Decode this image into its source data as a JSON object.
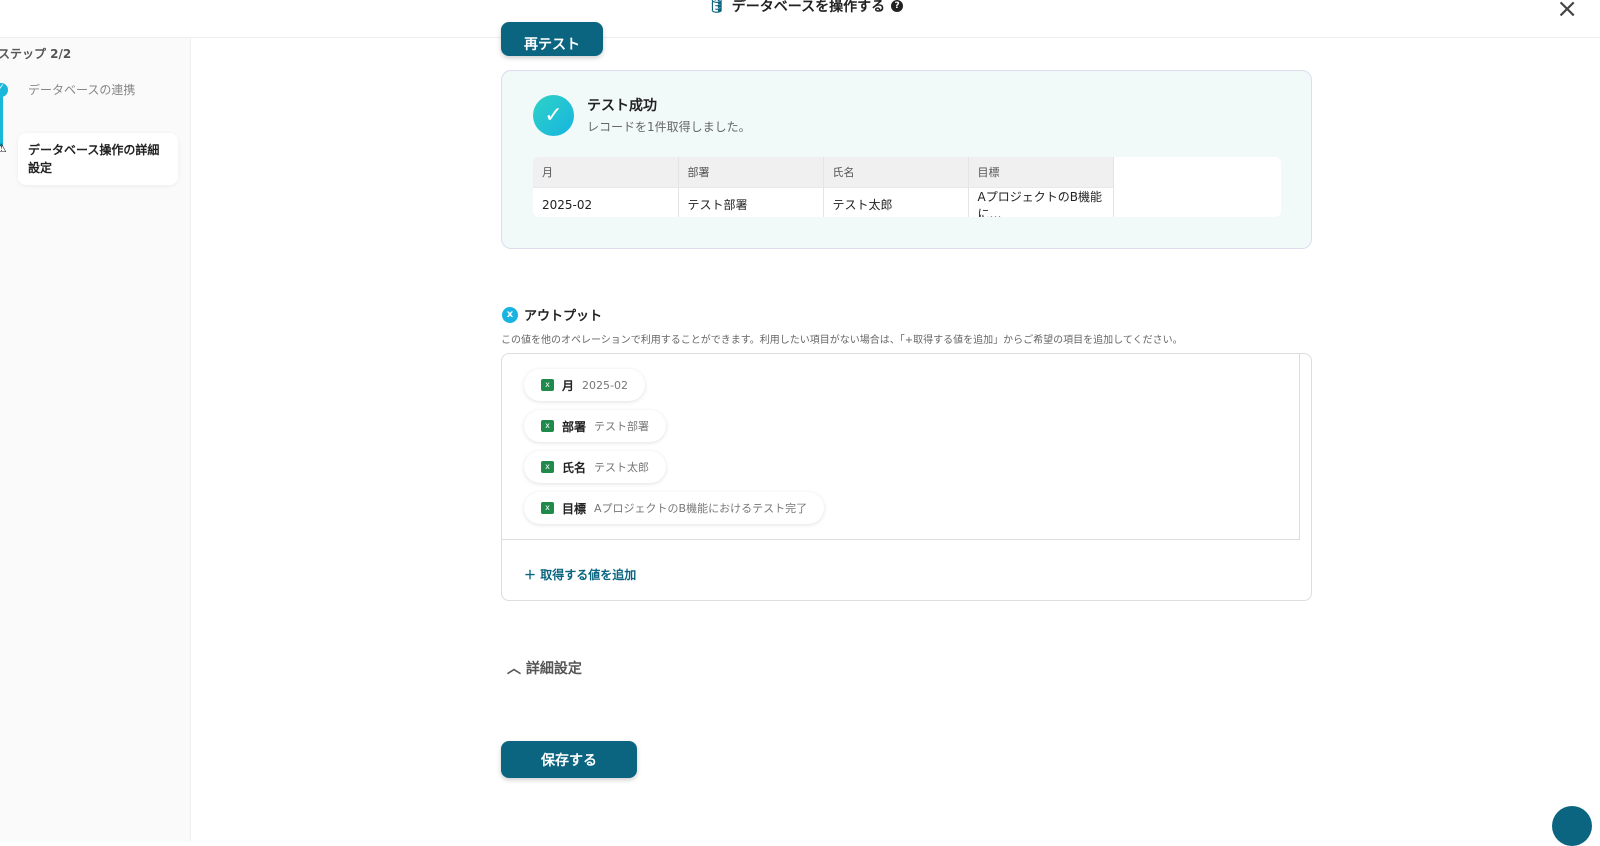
{
  "header": {
    "title": "データベースを操作する",
    "help_icon": "?",
    "close_icon": "×"
  },
  "sidebar": {
    "step_label": "ステップ 2/2",
    "steps": [
      {
        "label": "データベースの連携",
        "status": "done"
      },
      {
        "label": "データベース操作の詳細設定",
        "status": "warning"
      }
    ]
  },
  "retest_label": "再テスト",
  "test": {
    "title": "テスト成功",
    "subtitle": "レコードを1件取得しました。",
    "headers": [
      "月",
      "部署",
      "氏名",
      "目標"
    ],
    "row": [
      "2025-02",
      "テスト部署",
      "テスト太郎",
      "AプロジェクトのB機能に…"
    ]
  },
  "output": {
    "title": "アウトプット",
    "description": "この値を他のオペレーションで利用することができます。利用したい項目がない場合は、「+取得する値を追加」からご希望の項目を追加してください。",
    "items": [
      {
        "key": "月",
        "value": "2025-02"
      },
      {
        "key": "部署",
        "value": "テスト部署"
      },
      {
        "key": "氏名",
        "value": "テスト太郎"
      },
      {
        "key": "目標",
        "value": "AプロジェクトのB機能におけるテスト完了"
      }
    ],
    "add_label": "取得する値を追加"
  },
  "detail_label": "詳細設定",
  "save_label": "保存する"
}
